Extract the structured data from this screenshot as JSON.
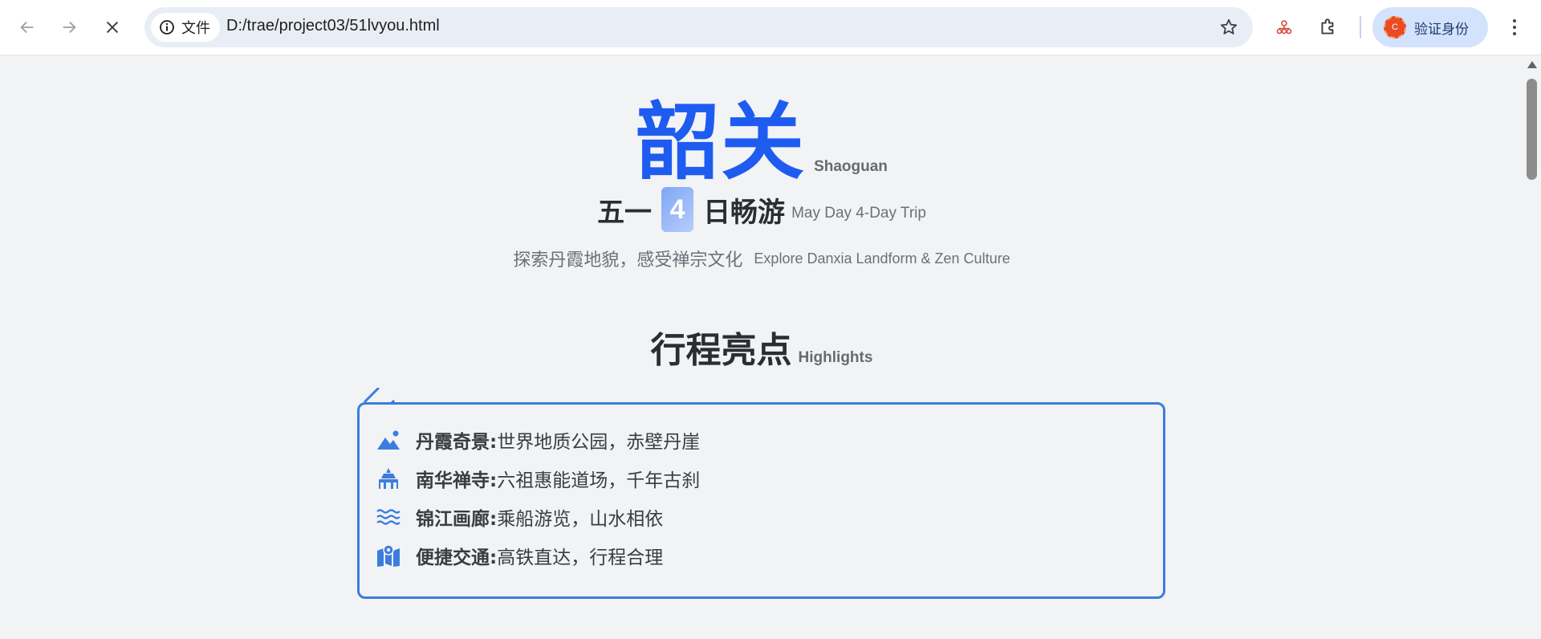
{
  "browser": {
    "chip_label": "文件",
    "url": "D:/trae/project03/51lvyou.html",
    "profile_label": "验证身份",
    "avatar_letter": "C"
  },
  "hero": {
    "title_cn": "韶关",
    "title_en": "Shaoguan",
    "sub_prefix": "五一",
    "day_count": "4",
    "sub_suffix": "日畅游",
    "sub_en": "May Day 4-Day Trip",
    "tagline_cn": "探索丹霞地貌，感受禅宗文化",
    "tagline_en": "Explore Danxia Landform & Zen Culture"
  },
  "highlights": {
    "heading_cn": "行程亮点",
    "heading_en": "Highlights",
    "items": [
      {
        "icon": "mountain-icon",
        "title": "丹霞奇景:",
        "desc": "世界地质公园，赤壁丹崖"
      },
      {
        "icon": "temple-icon",
        "title": "南华禅寺:",
        "desc": "六祖惠能道场，千年古刹"
      },
      {
        "icon": "water-icon",
        "title": "锦江画廊:",
        "desc": "乘船游览，山水相依"
      },
      {
        "icon": "map-pin-icon",
        "title": "便捷交通:",
        "desc": "高铁直达，行程合理"
      }
    ]
  },
  "colors": {
    "brand_blue": "#1e5cf0",
    "accent_blue": "#3b7ddd",
    "page_bg": "#f2f3f5"
  }
}
